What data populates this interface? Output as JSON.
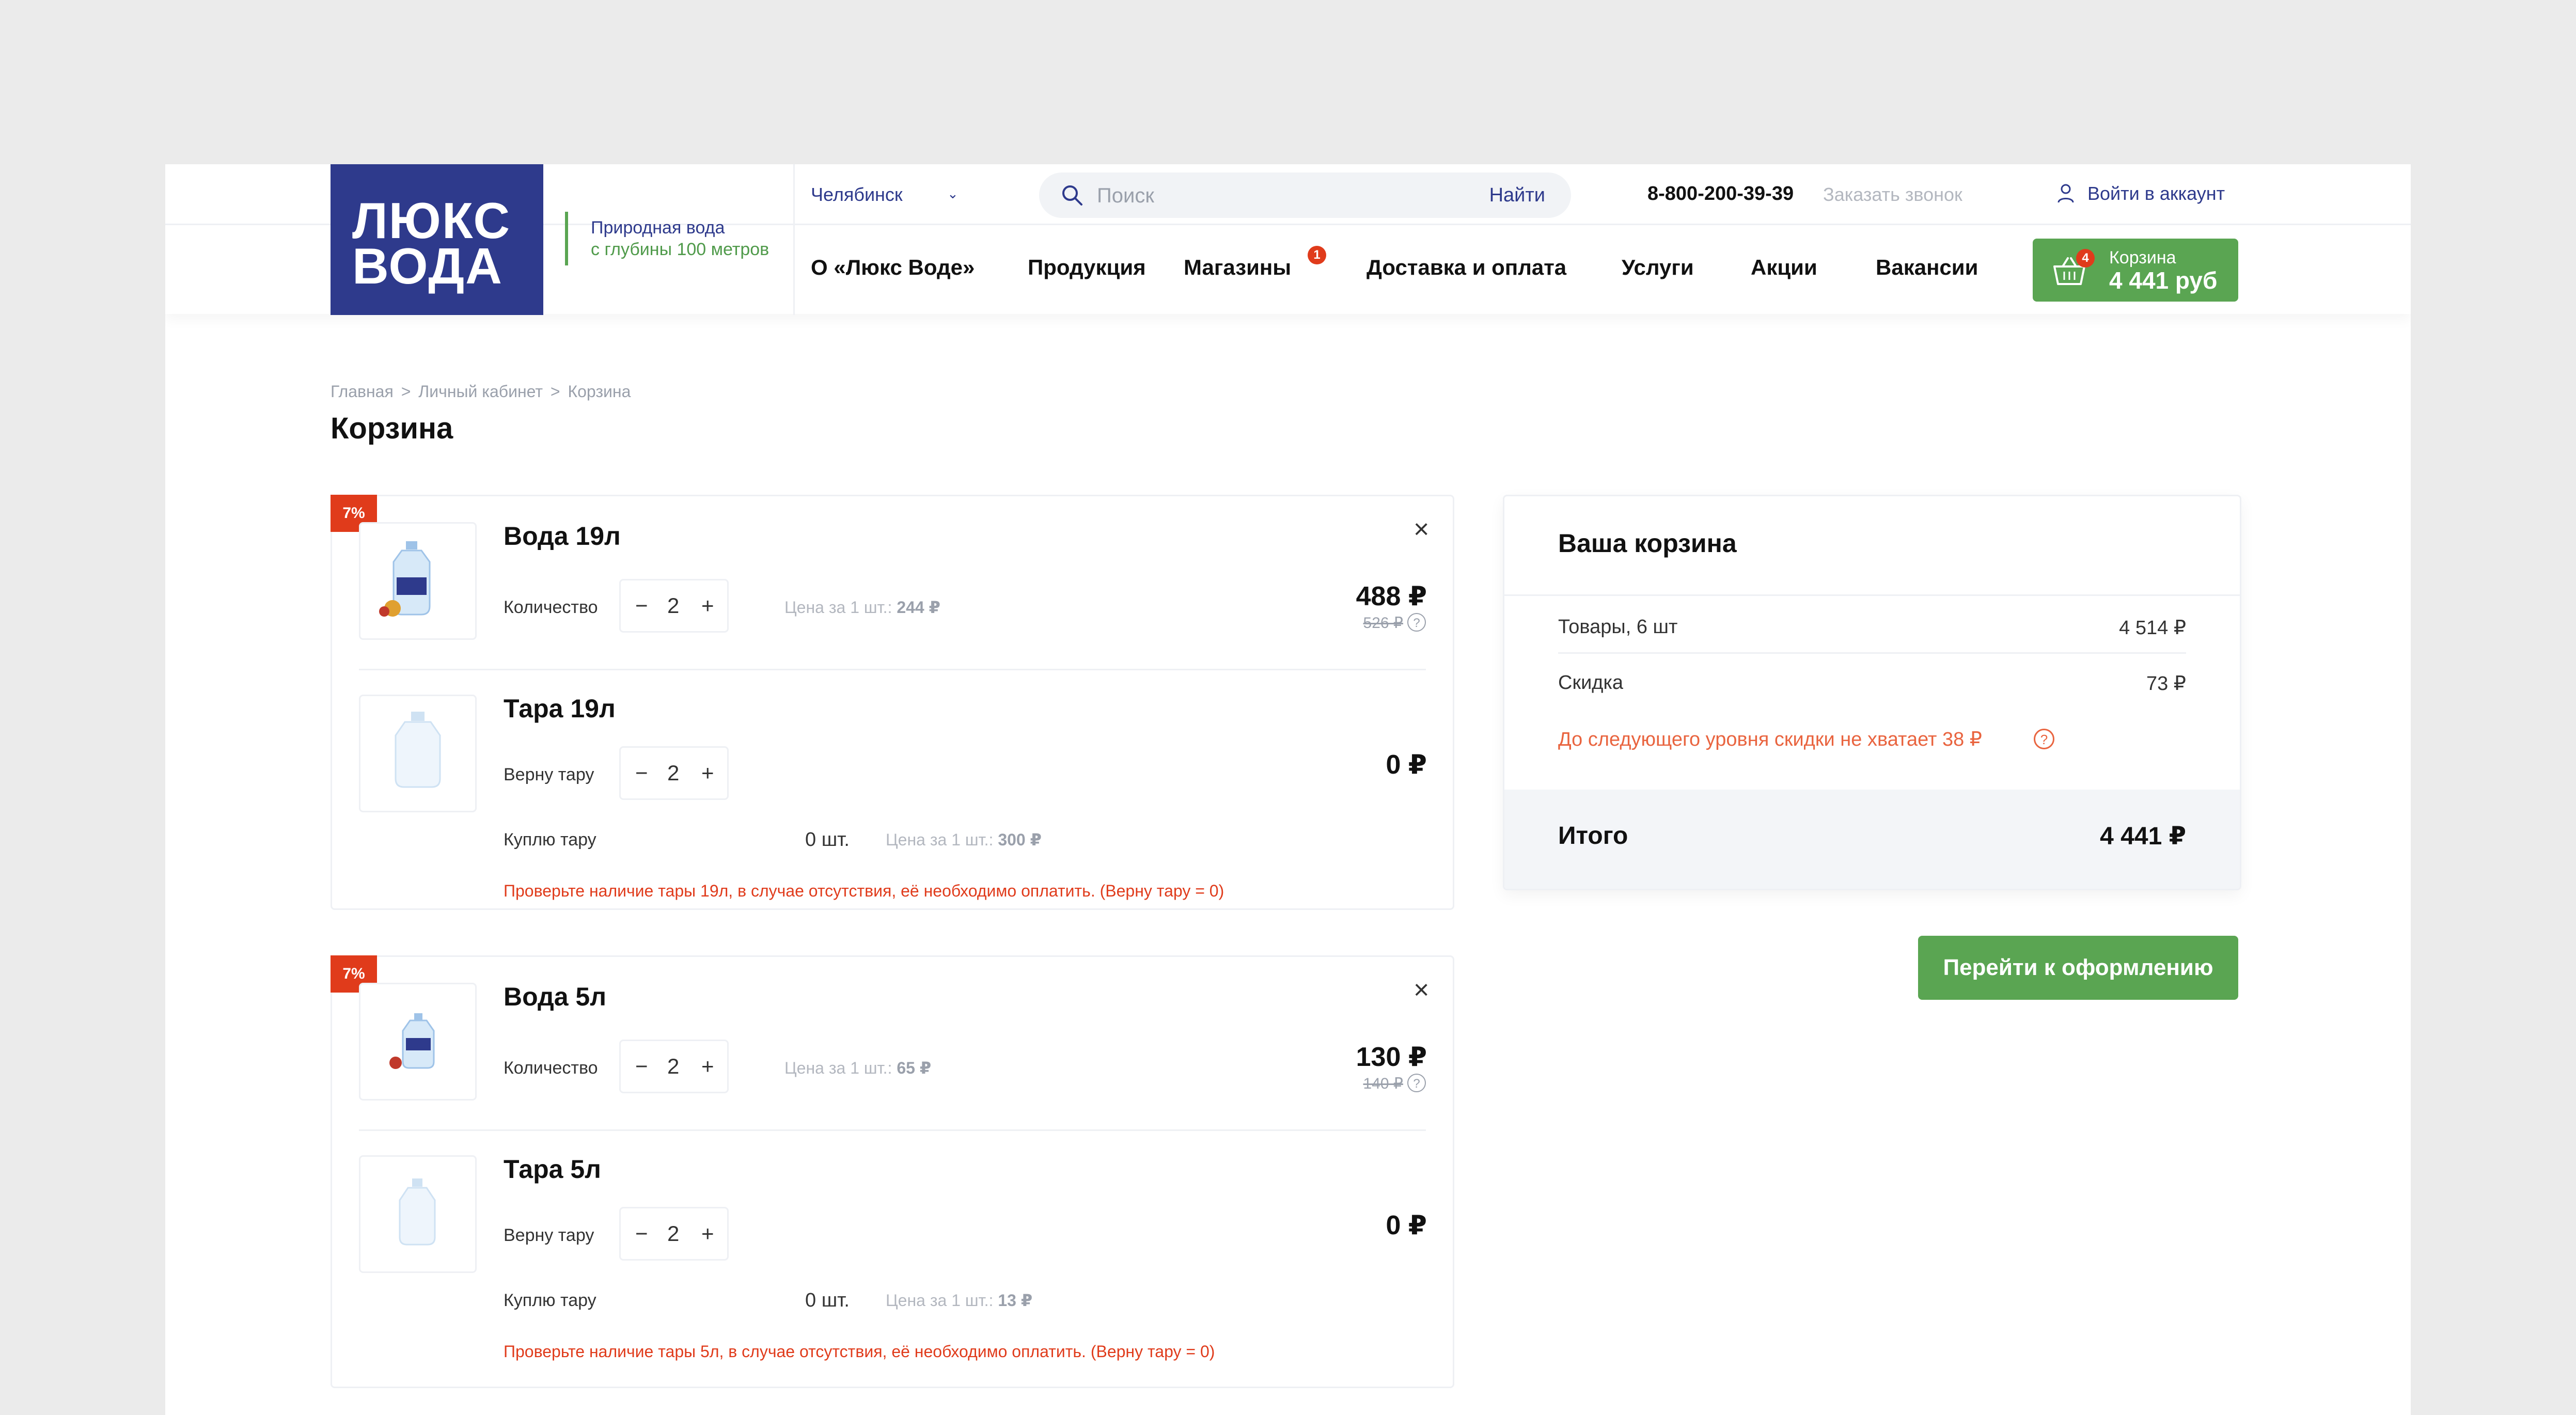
{
  "header": {
    "logo_line1": "ЛЮКС",
    "logo_line2": "ВОДА",
    "tagline_line1": "Природная вода",
    "tagline_line2": "с глубины 100 метров",
    "city": "Челябинск",
    "search_placeholder": "Поиск",
    "search_button": "Найти",
    "phone": "8-800-200-39-39",
    "callback": "Заказать звонок",
    "login": "Войти в аккаунт",
    "nav": [
      "О «Люкс Воде»",
      "Продукция",
      "Магазины",
      "Доставка и оплата",
      "Услуги",
      "Акции",
      "Вакансии"
    ],
    "nav_badge": "1",
    "cart_label": "Корзина",
    "cart_total": "4 441 руб",
    "cart_count": "4"
  },
  "breadcrumbs": [
    "Главная",
    ">",
    "Личный кабинет",
    ">",
    "Корзина"
  ],
  "page_title": "Корзина",
  "groups": [
    {
      "discount": "7%",
      "water": {
        "name": "Вода 19л",
        "qty_label": "Количество",
        "qty": "2",
        "unit_price_label": "Цена за 1 шт.:",
        "unit_price": "244 ₽",
        "price": "488 ₽",
        "old_price": "526 ₽"
      },
      "container": {
        "name": "Тара 19л",
        "return_label": "Верну тару",
        "return_qty": "2",
        "price": "0 ₽",
        "buy_label": "Куплю тару",
        "buy_qty": "0 шт.",
        "unit_price_label": "Цена за 1 шт.:",
        "unit_price": "300 ₽",
        "warning": "Проверьте наличие тары 19л, в случае отсутствия, её необходимо оплатить. (Верну тару = 0)"
      }
    },
    {
      "discount": "7%",
      "water": {
        "name": "Вода 5л",
        "qty_label": "Количество",
        "qty": "2",
        "unit_price_label": "Цена за 1 шт.:",
        "unit_price": "65 ₽",
        "price": "130 ₽",
        "old_price": "140 ₽"
      },
      "container": {
        "name": "Тара 5л",
        "return_label": "Верну тару",
        "return_qty": "2",
        "price": "0 ₽",
        "buy_label": "Куплю тару",
        "buy_qty": "0 шт.",
        "unit_price_label": "Цена за 1 шт.:",
        "unit_price": "13 ₽",
        "warning": "Проверьте наличие тары 5л, в случае отсутствия, её необходимо оплатить. (Верну тару = 0)"
      }
    }
  ],
  "summary": {
    "title": "Ваша корзина",
    "goods_label": "Товары, 6 шт",
    "goods_value": "4 514 ₽",
    "discount_label": "Скидка",
    "discount_value": "73 ₽",
    "next_level_note": "До следующего уровня скидки не хватает 38 ₽",
    "total_label": "Итого",
    "total_value": "4 441 ₽"
  },
  "checkout_button": "Перейти к оформлению",
  "colors": {
    "brand_blue": "#2e3a8c",
    "brand_green": "#5aa552",
    "alert_red": "#e03b1b",
    "note_orange": "#e9643f"
  }
}
